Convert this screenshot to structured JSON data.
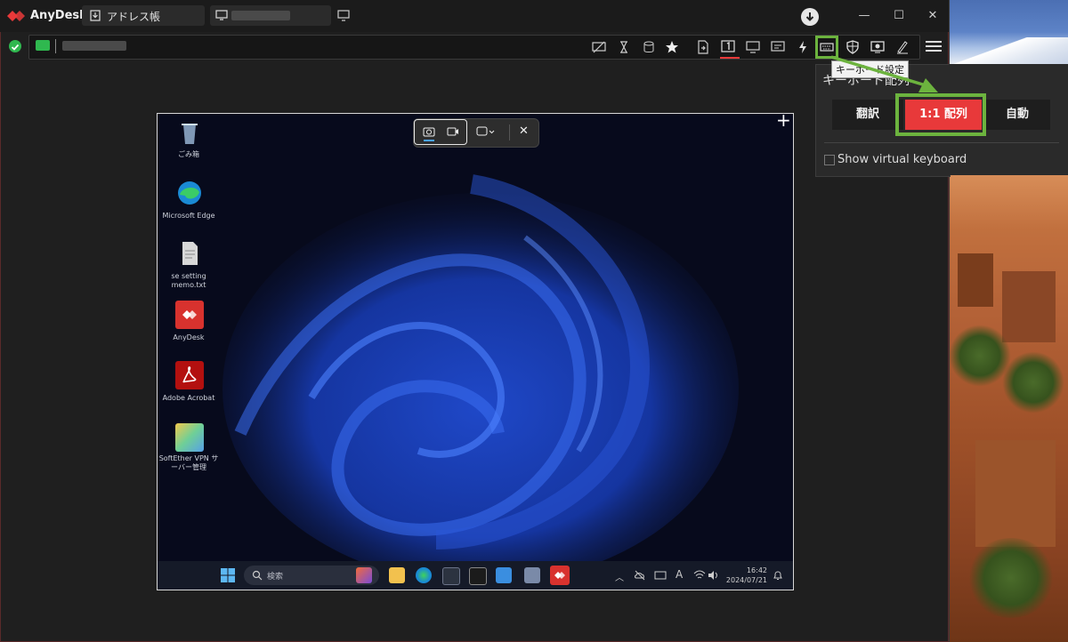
{
  "app": {
    "title": "AnyDesk",
    "brand_color": "#e8393a"
  },
  "tabs": [
    {
      "label": "アドレス帳",
      "icon": "download-icon"
    }
  ],
  "toolbar": {
    "icons": [
      "screen-off-icon",
      "hourglass-icon",
      "database-icon",
      "star-icon",
      "file-transfer-icon",
      "display-one-icon",
      "monitor-icon",
      "chat-icon",
      "lightning-icon",
      "keyboard-icon",
      "shield-icon",
      "remote-screen-icon",
      "pen-icon",
      "menu-icon"
    ]
  },
  "tooltip": "キーボード設定",
  "keyboard_popup": {
    "title": "キーボード配列",
    "buttons": [
      "翻訳",
      "1:1 配列",
      "自動"
    ],
    "selected": "1:1 配列",
    "selected_color": "#e8393a",
    "virtual_keyboard_label": "Show virtual keyboard",
    "virtual_keyboard_checked": false
  },
  "highlight_color": "#6cb33e",
  "remote_desktop": {
    "icons": [
      {
        "label": "ごみ箱",
        "icon": "recycle-bin-icon"
      },
      {
        "label": "Microsoft Edge",
        "icon": "edge-icon"
      },
      {
        "label": "se setting memo.txt",
        "icon": "text-file-icon"
      },
      {
        "label": "AnyDesk",
        "icon": "anydesk-icon"
      },
      {
        "label": "Adobe Acrobat",
        "icon": "acrobat-icon"
      },
      {
        "label": "SoftEther VPN サーバー管理",
        "icon": "softether-icon"
      }
    ],
    "taskbar": {
      "search_placeholder": "検索",
      "time": "16:42",
      "date": "2024/07/21"
    }
  }
}
